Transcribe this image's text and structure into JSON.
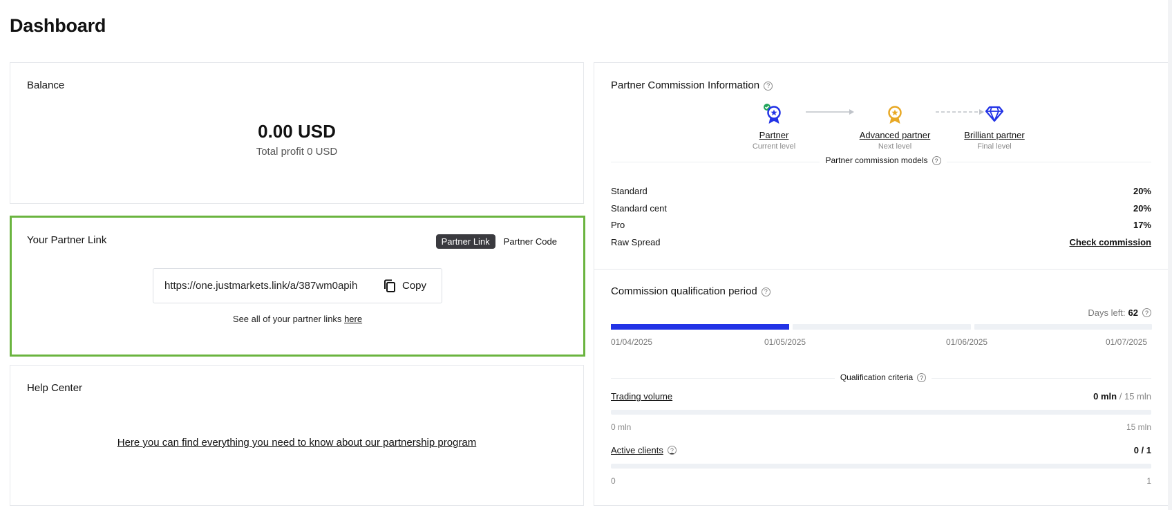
{
  "page": {
    "title": "Dashboard"
  },
  "balance": {
    "title": "Balance",
    "amount": "0.00 USD",
    "profit": "Total profit 0 USD"
  },
  "partner_link": {
    "title": "Your Partner Link",
    "toggle": {
      "link_label": "Partner Link",
      "code_label": "Partner Code",
      "selected": "Partner Link"
    },
    "url": "https://one.justmarkets.link/a/387wm0apih",
    "copy_label": "Copy",
    "see_all_text": "See all of your partner links",
    "see_all_link": "here"
  },
  "help_center": {
    "title": "Help Center",
    "link_text": "Here you can find everything you need to know about our partnership program"
  },
  "commission": {
    "title": "Partner Commission Information",
    "levels": [
      {
        "name": "Partner",
        "sub": "Current level",
        "icon": "medal-icon",
        "color": "#2233e6",
        "achieved": true
      },
      {
        "name": "Advanced partner",
        "sub": "Next level",
        "icon": "medal-icon",
        "color": "#e8a824",
        "achieved": false
      },
      {
        "name": "Brilliant partner",
        "sub": "Final level",
        "icon": "diamond-icon",
        "color": "#2233e6",
        "achieved": false
      }
    ],
    "models_title": "Partner commission models",
    "models": [
      {
        "name": "Standard",
        "value": "20%"
      },
      {
        "name": "Standard cent",
        "value": "20%"
      },
      {
        "name": "Pro",
        "value": "17%"
      },
      {
        "name": "Raw Spread",
        "value": "Check commission"
      }
    ]
  },
  "qualification": {
    "title": "Commission qualification period",
    "days_left_label": "Days left:",
    "days_left": "62",
    "dates": [
      "01/04/2025",
      "01/05/2025",
      "01/06/2025",
      "01/07/2025"
    ],
    "month_progress": [
      1.0,
      0.0,
      0.0
    ],
    "criteria_title": "Qualification criteria",
    "criteria": [
      {
        "name": "Trading volume",
        "current": "0 mln",
        "max": "/ 15 mln",
        "min_label": "0 mln",
        "max_label": "15 mln",
        "progress": 0
      },
      {
        "name": "Active clients",
        "current": "0 / 1",
        "max": "",
        "min_label": "0",
        "max_label": "1",
        "progress": 0
      }
    ]
  },
  "colors": {
    "accent": "#2233e6",
    "highlight_border": "#6ab43f",
    "gold": "#e8a824",
    "success": "#22a55b"
  }
}
